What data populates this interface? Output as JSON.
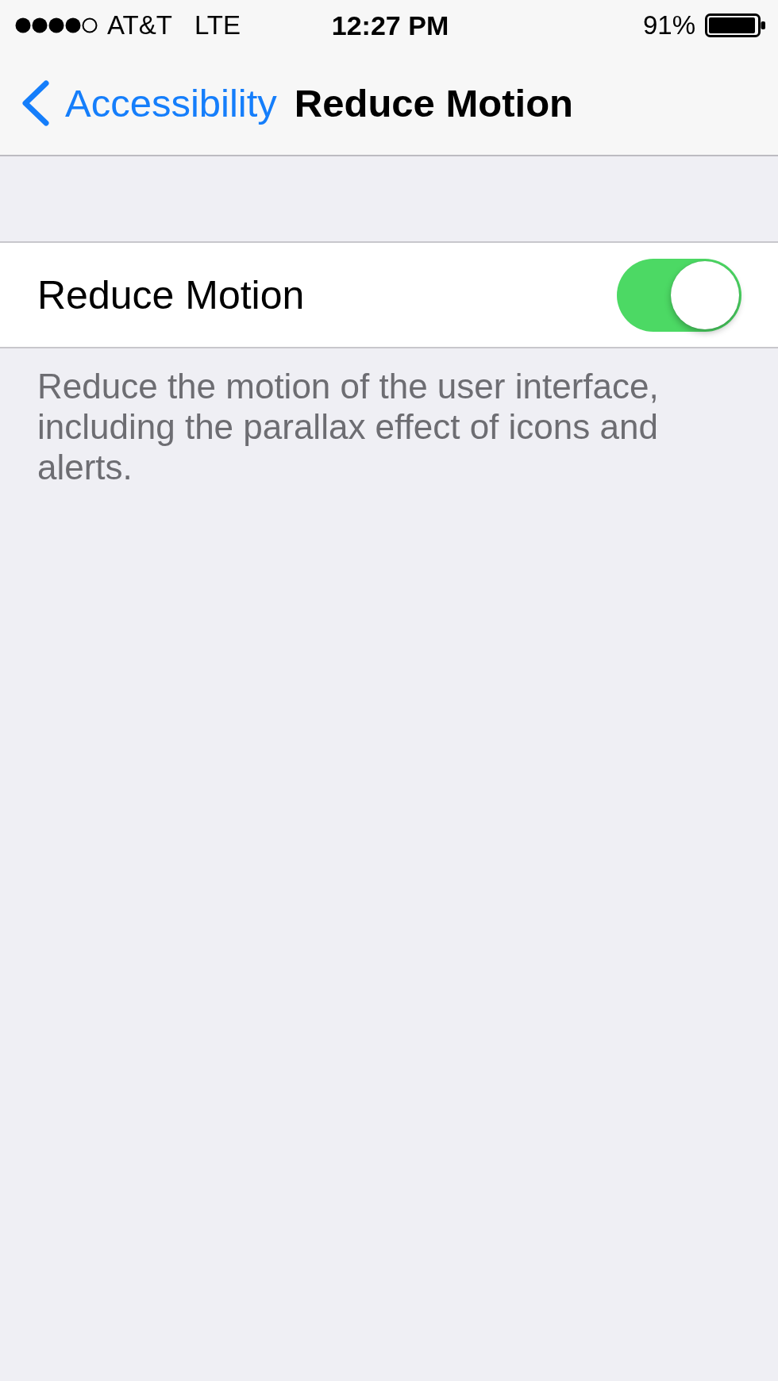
{
  "status_bar": {
    "carrier": "AT&T",
    "network": "LTE",
    "time": "12:27 PM",
    "battery": "91%"
  },
  "nav_bar": {
    "back_label": "Accessibility",
    "title": "Reduce Motion"
  },
  "settings": [
    {
      "kind": "switch",
      "label": "Reduce Motion",
      "on": true
    }
  ],
  "footer": "Reduce the motion of the user interface, including the parallax effect of icons and alerts."
}
